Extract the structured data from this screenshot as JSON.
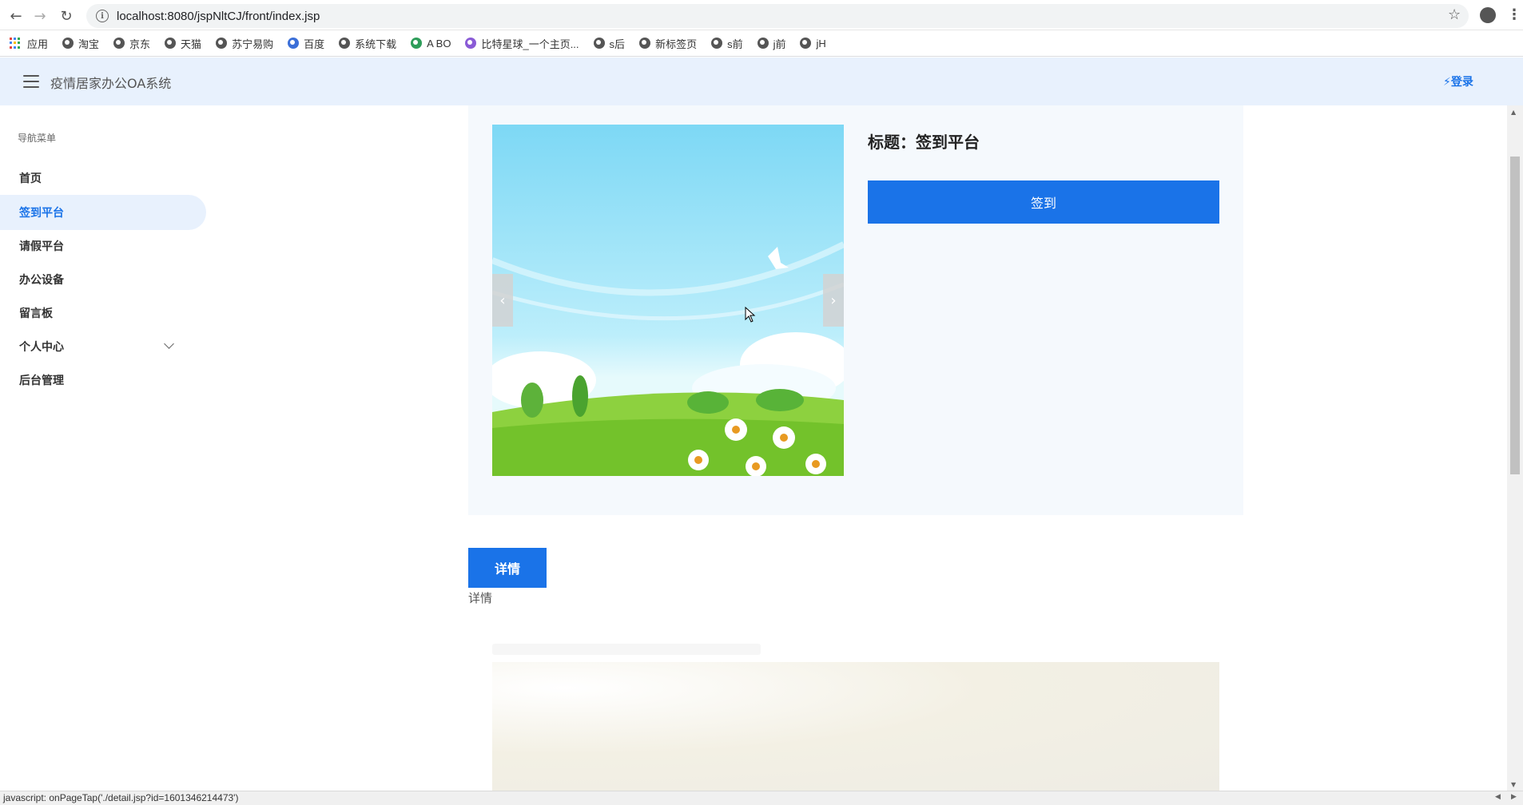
{
  "browser": {
    "url": "localhost:8080/jspNltCJ/front/index.jsp",
    "bookmarks": [
      {
        "label": "应用",
        "icon": "apps-icon"
      },
      {
        "label": "淘宝",
        "icon": "globe-icon"
      },
      {
        "label": "京东",
        "icon": "globe-icon"
      },
      {
        "label": "天猫",
        "icon": "globe-icon"
      },
      {
        "label": "苏宁易购",
        "icon": "globe-icon"
      },
      {
        "label": "百度",
        "icon": "baidu-paw-icon"
      },
      {
        "label": "系统下载",
        "icon": "globe-icon"
      },
      {
        "label": "A BO",
        "icon": "leaf-icon"
      },
      {
        "label": "比特星球_一个主页...",
        "icon": "planet-icon"
      },
      {
        "label": "s后",
        "icon": "globe-icon"
      },
      {
        "label": "新标签页",
        "icon": "globe-icon"
      },
      {
        "label": "s前",
        "icon": "globe-icon"
      },
      {
        "label": "j前",
        "icon": "globe-icon"
      },
      {
        "label": "jH",
        "icon": "globe-icon"
      }
    ]
  },
  "header": {
    "title": "疫情居家办公OA系统",
    "login_label": "⚡登录"
  },
  "sidebar": {
    "title": "导航菜单",
    "items": [
      {
        "label": "首页"
      },
      {
        "label": "签到平台"
      },
      {
        "label": "请假平台"
      },
      {
        "label": "办公设备"
      },
      {
        "label": "留言板"
      },
      {
        "label": "个人中心"
      },
      {
        "label": "后台管理"
      }
    ]
  },
  "main": {
    "title": "标题：签到平台",
    "signin_label": "签到",
    "prev_label": "‹",
    "next_label": "›",
    "detail_button": "详情",
    "detail_text": "详情"
  },
  "statusbar": {
    "text": "javascript: onPageTap('./detail.jsp?id=1601346214473')"
  },
  "colors": {
    "primary": "#1a73e8",
    "header_bg": "#e8f1fd",
    "card_bg": "#f5f9fd"
  }
}
